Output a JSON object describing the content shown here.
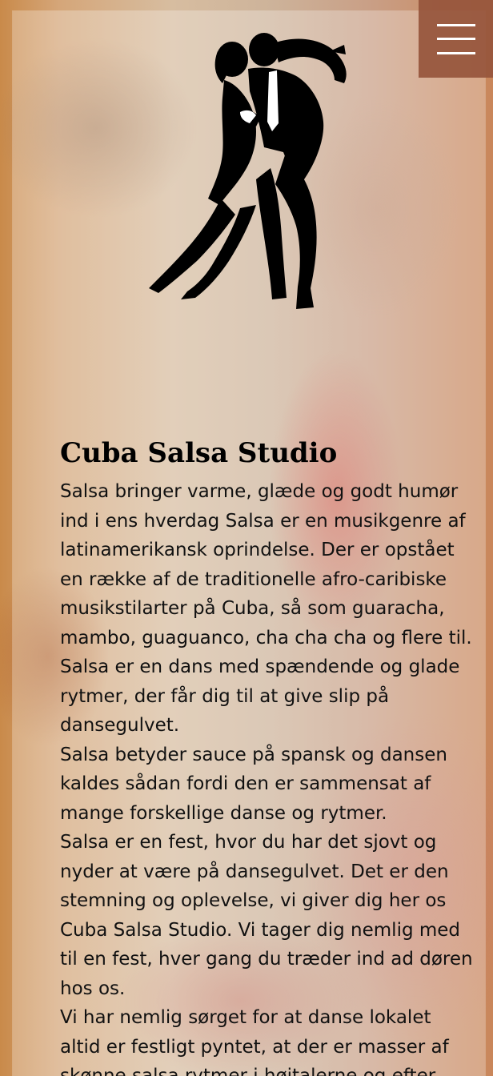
{
  "header": {
    "menu_icon": "hamburger-menu-icon",
    "logo_icon": "salsa-dancers-silhouette-icon"
  },
  "article": {
    "title": "Cuba Salsa Studio",
    "paragraphs": [
      "Salsa bringer varme, glæde og godt humør ind i ens hverdag Salsa er en musikgenre af latinamerikansk oprindelse. Der er opstået en række af de traditionelle afro-caribiske musikstilarter på Cuba, så som guaracha, mambo, guaguanco, cha cha cha og flere til. Salsa er en dans med spændende og glade rytmer, der får dig til at give slip på dansegulvet.",
      "Salsa betyder sauce på spansk og dansen kaldes sådan fordi den er sammensat af mange forskellige danse og rytmer.",
      "Salsa er en fest, hvor du har det sjovt og nyder at være på dansegulvet. Det er den stemning og oplevelse, vi giver dig her os Cuba Salsa Studio. Vi tager dig nemlig med til en fest, hver gang du træder ind ad døren hos os.",
      "Vi har nemlig sørget for at danse lokalet altid er festligt pyntet, at der er masser af skønne salsa rytmer i højtalerne og efter"
    ]
  },
  "colors": {
    "menu_background": "#96553c",
    "text": "#111111",
    "silhouette": "#000000"
  }
}
